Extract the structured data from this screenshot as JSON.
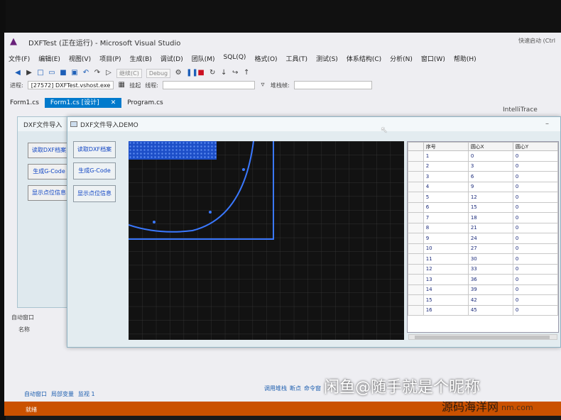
{
  "vs": {
    "title": "DXFTest (正在运行) - Microsoft Visual Studio",
    "quick_launch": "快速启动 (Ctrl",
    "menu": [
      "文件(F)",
      "编辑(E)",
      "视图(V)",
      "项目(P)",
      "生成(B)",
      "调试(D)",
      "团队(M)",
      "SQL(Q)",
      "格式(O)",
      "工具(T)",
      "测试(S)",
      "体系结构(C)",
      "分析(N)",
      "窗口(W)",
      "帮助(H)"
    ],
    "toolbar": {
      "continue_label": "继续(C)",
      "config": "Debug"
    },
    "toolbar2": {
      "process_label": "进程:",
      "process_value": "[27572] DXFTest.vshost.exe",
      "lifecycle_label": "挂起",
      "thread_label": "线程:",
      "stackframe_label": "堆栈帧:"
    },
    "tabs": [
      "Form1.cs",
      "Form1.cs [设计]",
      "Program.cs"
    ],
    "intellitrace": "IntelliTrace",
    "left_panel": {
      "title": "自动窗口",
      "col": "名称"
    },
    "bottom_tabs": [
      "自动窗口",
      "局部变量",
      "监视 1"
    ],
    "bottom_tabs_right": [
      "调用堆栈",
      "断点",
      "命令窗"
    ],
    "status": "就绪"
  },
  "form_back": {
    "title": "DXF文件导入",
    "buttons": [
      "读取DXF档案",
      "生成G-Code",
      "显示点位信息"
    ]
  },
  "form_front": {
    "title": "DXF文件导入DEMO",
    "buttons": [
      "读取DXF档案",
      "生成G-Code",
      "显示点位信息"
    ],
    "grid": {
      "headers": [
        "序号",
        "圆心X",
        "圆心Y"
      ],
      "rows": [
        [
          "1",
          "0",
          "0"
        ],
        [
          "2",
          "3",
          "0"
        ],
        [
          "3",
          "6",
          "0"
        ],
        [
          "4",
          "9",
          "0"
        ],
        [
          "5",
          "12",
          "0"
        ],
        [
          "6",
          "15",
          "0"
        ],
        [
          "7",
          "18",
          "0"
        ],
        [
          "8",
          "21",
          "0"
        ],
        [
          "9",
          "24",
          "0"
        ],
        [
          "10",
          "27",
          "0"
        ],
        [
          "11",
          "30",
          "0"
        ],
        [
          "12",
          "33",
          "0"
        ],
        [
          "13",
          "36",
          "0"
        ],
        [
          "14",
          "39",
          "0"
        ],
        [
          "15",
          "42",
          "0"
        ],
        [
          "16",
          "45",
          "0"
        ]
      ]
    }
  },
  "watermark": {
    "line1": "闲鱼@随手就是个昵称",
    "line2": "源码海洋网",
    "line3": "nm.com"
  }
}
